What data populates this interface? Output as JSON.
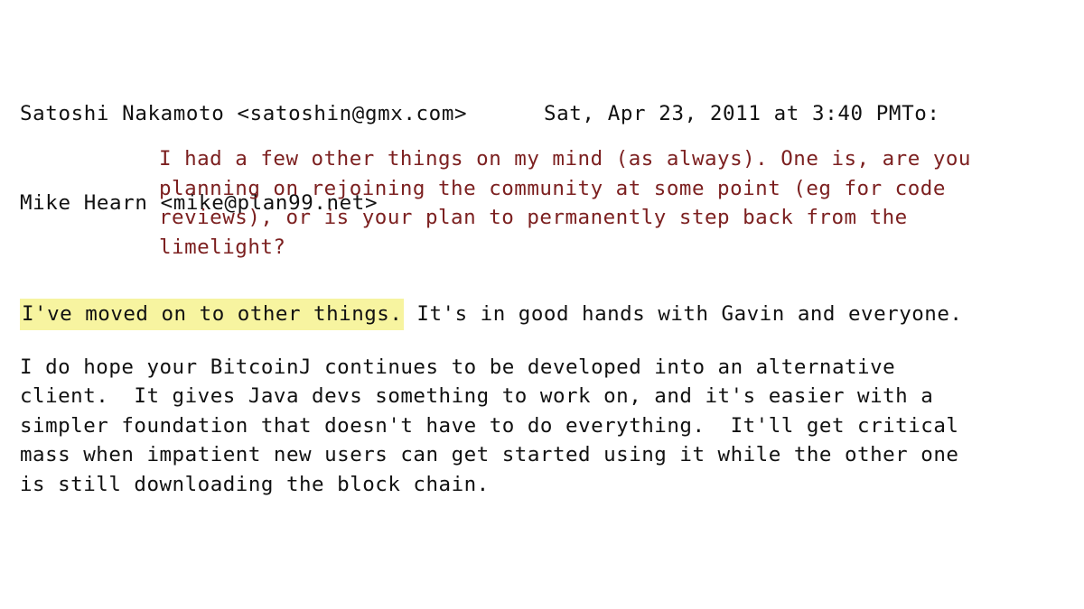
{
  "document": {
    "type": "email-screenshot",
    "background_color": "#ffffff",
    "text_color": "#111111",
    "quote_color": "#7c2020",
    "highlight_color": "#f7f4a0"
  },
  "header": {
    "line1": "Satoshi Nakamoto <satoshin@gmx.com>      Sat, Apr 23, 2011 at 3:40 PMTo:",
    "line2": "Mike Hearn <mike@plan99.net>",
    "sender_name": "Satoshi Nakamoto",
    "sender_email": "<satoshin@gmx.com>",
    "timestamp": "Sat, Apr 23, 2011 at 3:40 PM",
    "to_label": "To:",
    "recipient_name": "Mike Hearn",
    "recipient_email": "<mike@plan99.net>"
  },
  "quoted": {
    "lines": [
      "I had a few other things on my mind (as always). One is, are you",
      "planning on rejoining the community at some point (eg for code",
      "reviews), or is your plan to permanently step back from the",
      "limelight?"
    ]
  },
  "reply": {
    "highlighted_sentence": "I've moved on to other things.",
    "highlight_line_rest": " It's in good hands with Gavin and everyone.",
    "paragraph_lines": [
      "I do hope your BitcoinJ continues to be developed into an alternative",
      "client.  It gives Java devs something to work on, and it's easier with a",
      "simpler foundation that doesn't have to do everything.  It'll get critical",
      "mass when impatient new users can get started using it while the other one",
      "is still downloading the block chain."
    ]
  }
}
